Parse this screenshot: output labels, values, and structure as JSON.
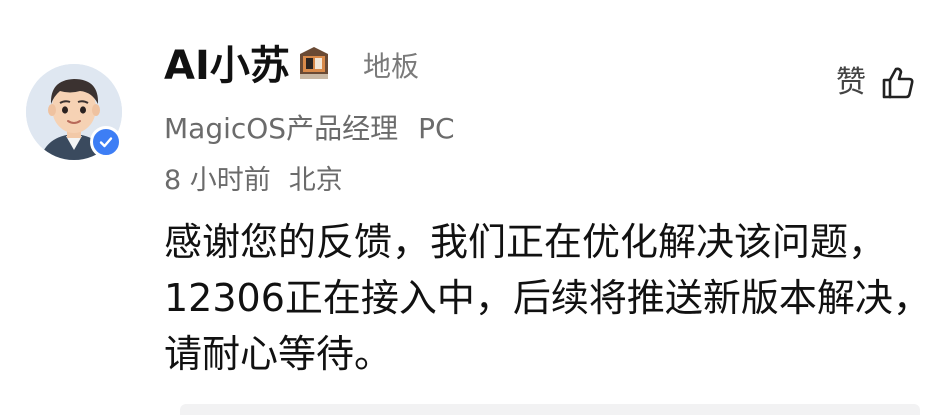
{
  "comment": {
    "author": {
      "name": "AI小苏",
      "title": "MagicOS产品经理",
      "device": "PC",
      "verified": true,
      "badge_icon": "rank-badge-icon",
      "avatar_icon": "avatar-cartoon-boy"
    },
    "floor_label": "地板",
    "like_label": "赞",
    "time": "8 小时前",
    "location": "北京",
    "content": "感谢您的反馈，我们正在优化解决该问题，12306正在接入中，后续将推送新版本解决，请耐心等待。",
    "colors": {
      "verified_blue": "#3d7ef5",
      "meta_gray": "#6b6b6b",
      "text": "#111111"
    }
  }
}
